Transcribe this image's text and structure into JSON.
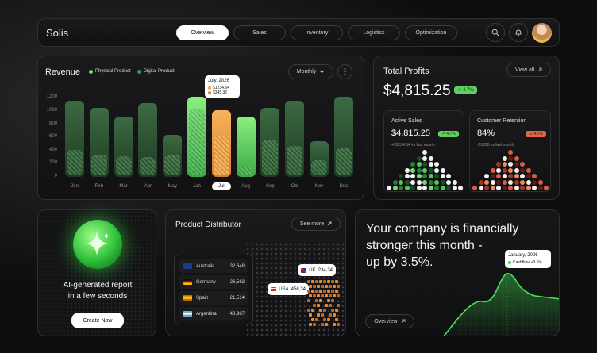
{
  "nav": {
    "logo": "Solis",
    "tabs": [
      "Overview",
      "Sales",
      "Inventory",
      "Logistics",
      "Optimization"
    ]
  },
  "revenue": {
    "title": "Revenue",
    "legend": [
      "Physical Product",
      "Digital Product"
    ],
    "period": "Monthly",
    "tooltip": {
      "date": "July, 2026",
      "v1": "$1234.54",
      "v2": "$345.32"
    },
    "colors": {
      "physical": "#6fdc6f",
      "digital": "#3d8a4a",
      "highlight": "#f0a04b"
    }
  },
  "chart_data": {
    "type": "bar",
    "categories": [
      "Jan",
      "Feb",
      "Mar",
      "Apr",
      "May",
      "Jun",
      "Jul",
      "Aug",
      "Sep",
      "Oct",
      "Nov",
      "Dec"
    ],
    "series": [
      {
        "name": "Physical Product",
        "values": [
          1150,
          1050,
          920,
          1120,
          640,
          1210,
          1010,
          910,
          1050,
          1160,
          540,
          1210
        ]
      },
      {
        "name": "Digital Product",
        "values": [
          410,
          340,
          310,
          300,
          340,
          1030,
          620,
          150,
          560,
          470,
          250,
          430
        ]
      }
    ],
    "yticks": [
      0,
      200,
      400,
      600,
      800,
      1000,
      1200
    ],
    "ylim": [
      0,
      1300
    ],
    "highlight": "Jul"
  },
  "profits": {
    "title": "Total Profits",
    "view_all": "View all",
    "amount": "$4,815.25",
    "change": "4.7%",
    "active": {
      "title": "Active Sales",
      "value": "$4,815.25",
      "badge": "4.7%",
      "sub": "+$1234.54 vs last month"
    },
    "retention": {
      "title": "Customer Retention",
      "value": "84%",
      "badge": "4.7%",
      "sub": "-$1356 vs last month"
    }
  },
  "ai": {
    "text1": "AI-generated report",
    "text2": "in a few seconds",
    "button": "Create Now"
  },
  "distributor": {
    "title": "Product Distributor",
    "see_more": "See more",
    "rows": [
      {
        "country": "Australia",
        "value": "32,648"
      },
      {
        "country": "Germany",
        "value": "26,563"
      },
      {
        "country": "Spain",
        "value": "21,514"
      },
      {
        "country": "Argentina",
        "value": "43,987"
      }
    ],
    "uk": {
      "label": "UK",
      "value": "234,34"
    },
    "usa": {
      "label": "USA",
      "value": "456,34"
    }
  },
  "promo": {
    "line1": "Your company is financially",
    "line2": "stronger this month -",
    "line3": "up by 3.5%.",
    "tooltip_date": "January, 2026",
    "tooltip_label": "Cashflow",
    "tooltip_value": "+3.5%",
    "button": "Overview"
  }
}
